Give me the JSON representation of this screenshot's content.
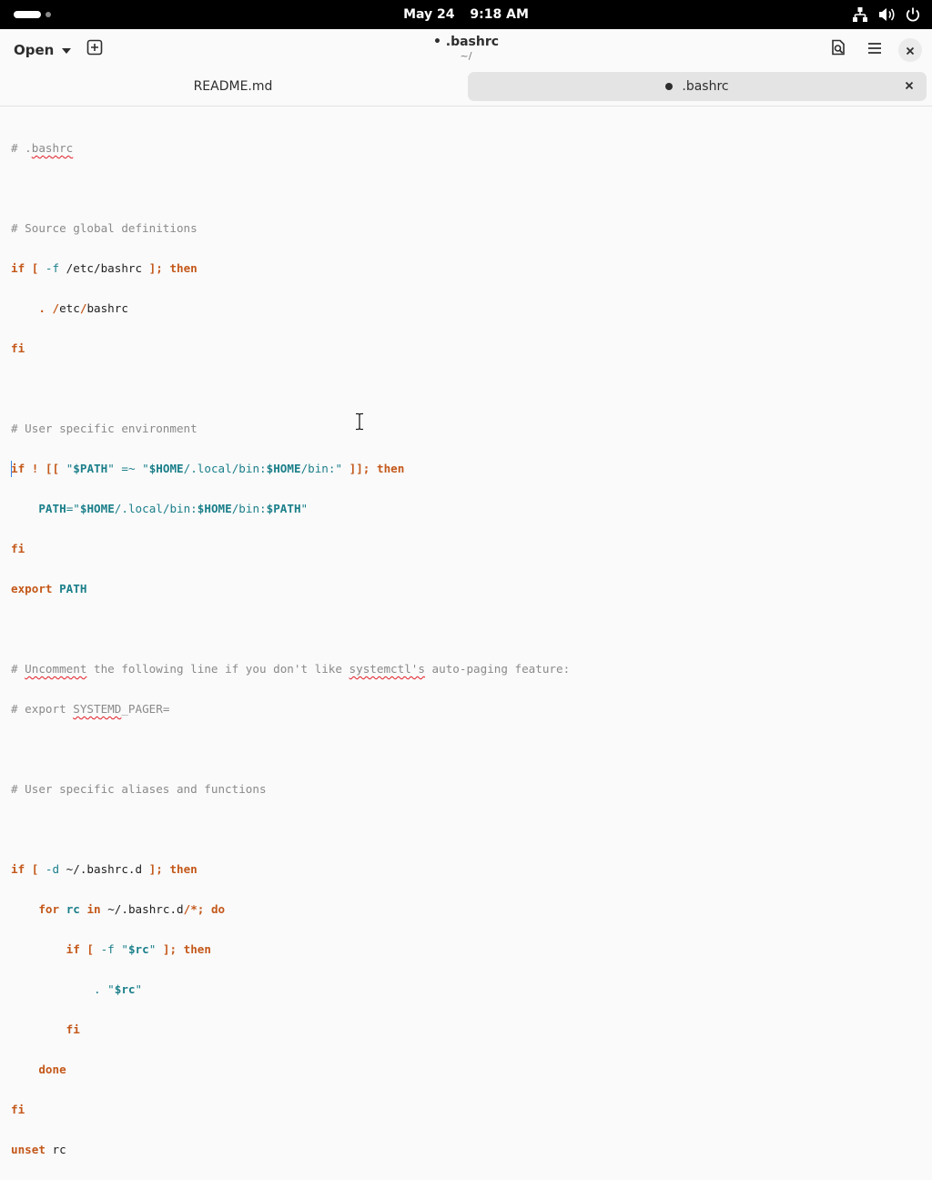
{
  "topbar": {
    "date": "May 24",
    "time": "9:18 AM"
  },
  "header": {
    "open_label": "Open",
    "title": "• .bashrc",
    "subtitle": "~/"
  },
  "tabs": [
    {
      "label": "README.md",
      "active": false
    },
    {
      "label": ".bashrc",
      "active": true,
      "modified": true
    }
  ],
  "icons": [
    "activities-pill",
    "workspace-dot",
    "network-icon",
    "volume-icon",
    "power-icon",
    "chevron-down-icon",
    "new-tab-icon",
    "document-search-icon",
    "hamburger-menu-icon",
    "close-icon",
    "tab-close-icon",
    "ibeam-cursor-icon"
  ],
  "colors": {
    "comment": "#8a8a8a",
    "keyword": "#c4581a",
    "variable": "#1b7f8a",
    "spell_error": "#e01b24",
    "cursor": "#3584e4"
  },
  "editor": {
    "l1": {
      "a": "# .",
      "b": "bashrc"
    },
    "l3": "# Source global definitions",
    "l4": {
      "a": "if",
      "b": " [ ",
      "c": "-f",
      "d": " /etc/bashrc ",
      "e": "];",
      "f": " ",
      "g": "then"
    },
    "l5": {
      "a": "    . ",
      "b": "/",
      "c": "etc",
      "d": "/",
      "e": "bashrc"
    },
    "l6": "fi",
    "l8": "# User specific environment",
    "l9": {
      "a": "if",
      "b": " ",
      "c": "! [[",
      "d": " \"",
      "e": "$PATH",
      "f": "\" ",
      "g": "=~",
      "h": " \"",
      "i": "$HOME",
      "j": "/.local/bin:",
      "k": "$HOME",
      "l": "/bin:\"",
      "m": " ]];",
      "n": " ",
      "o": "then"
    },
    "l10": {
      "a": "    ",
      "b": "PATH",
      "c": "=\"",
      "d": "$HOME",
      "e": "/.local/bin:",
      "f": "$HOME",
      "g": "/bin:",
      "h": "$PATH",
      "i": "\""
    },
    "l11": "fi",
    "l12": {
      "a": "export",
      "b": " ",
      "c": "PATH"
    },
    "l14": {
      "a": "# ",
      "b": "Uncomment",
      "c": " the following line if you don't like ",
      "d": "systemctl's",
      "e": " auto-paging feature:"
    },
    "l15": {
      "a": "# export ",
      "b": "SYSTEMD",
      "c": "_PAGER="
    },
    "l17": "# User specific aliases and functions",
    "l19": {
      "a": "if",
      "b": " [ ",
      "c": "-d",
      "d": " ~/.bashrc.d ",
      "e": "];",
      "f": " ",
      "g": "then"
    },
    "l20": {
      "a": "    ",
      "b": "for",
      "c": " ",
      "d": "rc",
      "e": " ",
      "f": "in",
      "g": " ~/.bashrc.d",
      "h": "/*;",
      "i": " ",
      "j": "do"
    },
    "l21": {
      "a": "        ",
      "b": "if",
      "c": " [ ",
      "d": "-f",
      "e": " \"",
      "f": "$rc",
      "g": "\" ",
      "h": "];",
      "i": " ",
      "j": "then"
    },
    "l22": {
      "a": "            . \"",
      "b": "$rc",
      "c": "\""
    },
    "l23": {
      "a": "        ",
      "b": "fi"
    },
    "l24": {
      "a": "    ",
      "b": "done"
    },
    "l25": "fi",
    "l26": {
      "a": "unset",
      "b": " rc"
    }
  }
}
